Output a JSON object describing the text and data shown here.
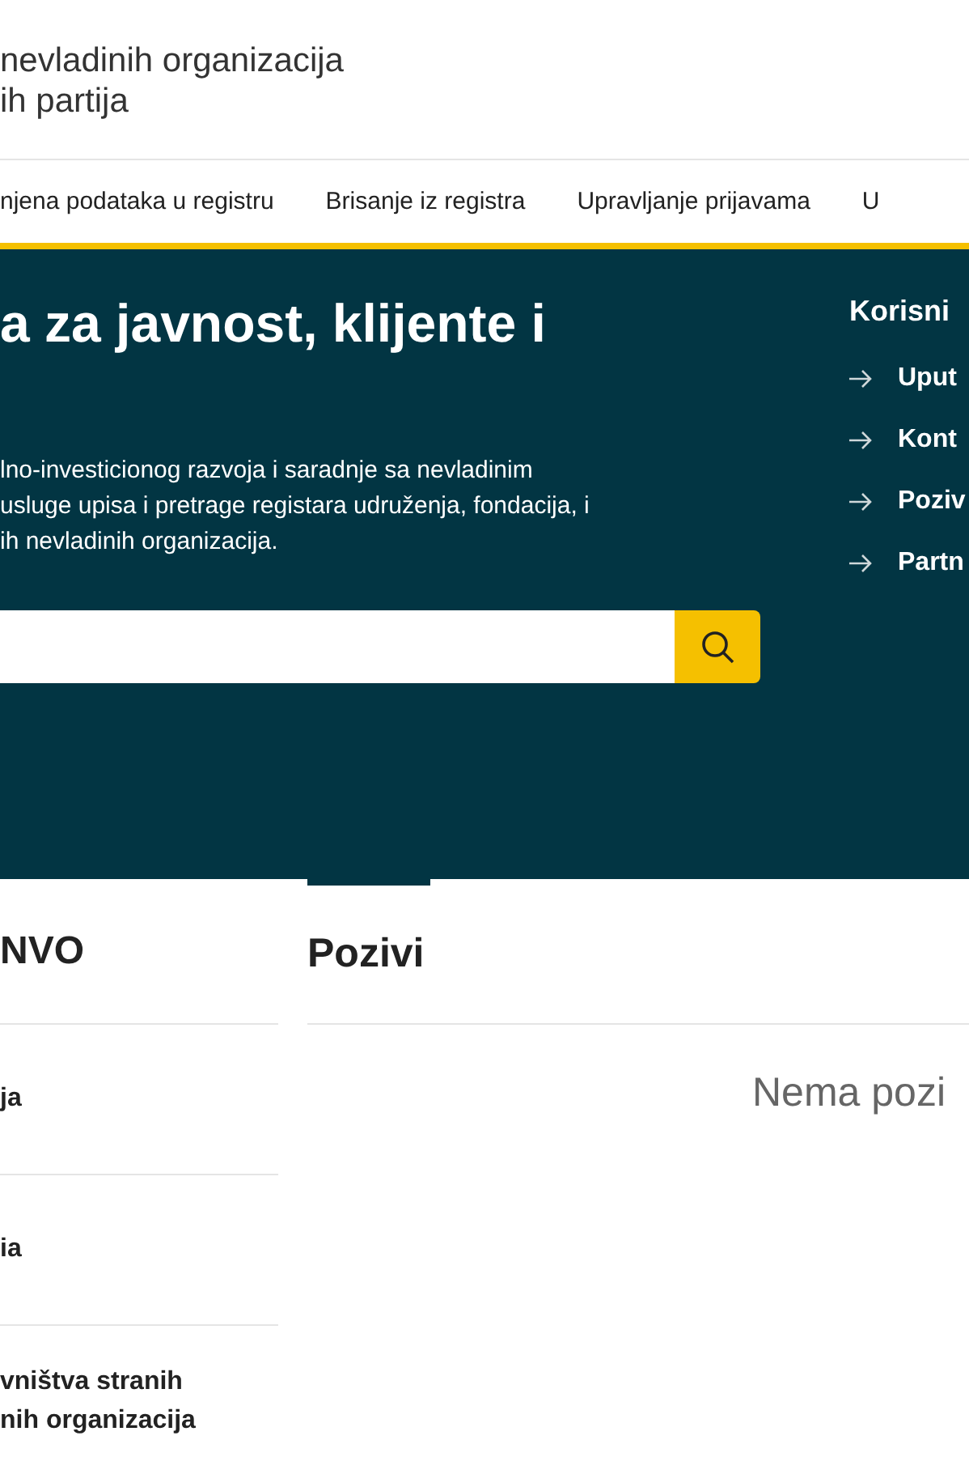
{
  "header": {
    "title_lines": [
      "nevladinih organizacija",
      "ih partija"
    ]
  },
  "nav": {
    "items": [
      {
        "label": "njena podataka u registru"
      },
      {
        "label": "Brisanje iz registra"
      },
      {
        "label": "Upravljanje prijavama"
      },
      {
        "label": "U"
      }
    ]
  },
  "hero": {
    "heading": "a za javnost, klijente i",
    "description_lines": [
      "lno-investicionog razvoja i saradnje sa nevladinim",
      "usluge upisa i pretrage registara udruženja, fondacija, i",
      "ih nevladinih organizacija."
    ],
    "side_heading": "Korisni",
    "side_links": [
      {
        "label": "Uput"
      },
      {
        "label": "Kont"
      },
      {
        "label": "Poziv"
      },
      {
        "label": "Partn"
      }
    ]
  },
  "sidebar": {
    "heading": "NVO",
    "items": [
      {
        "lines": [
          "ja"
        ]
      },
      {
        "lines": [
          "ia"
        ]
      },
      {
        "lines": [
          "vništva stranih",
          "nih organizacija"
        ]
      }
    ]
  },
  "main": {
    "heading": "Pozivi",
    "empty_message": "Nema pozi"
  }
}
